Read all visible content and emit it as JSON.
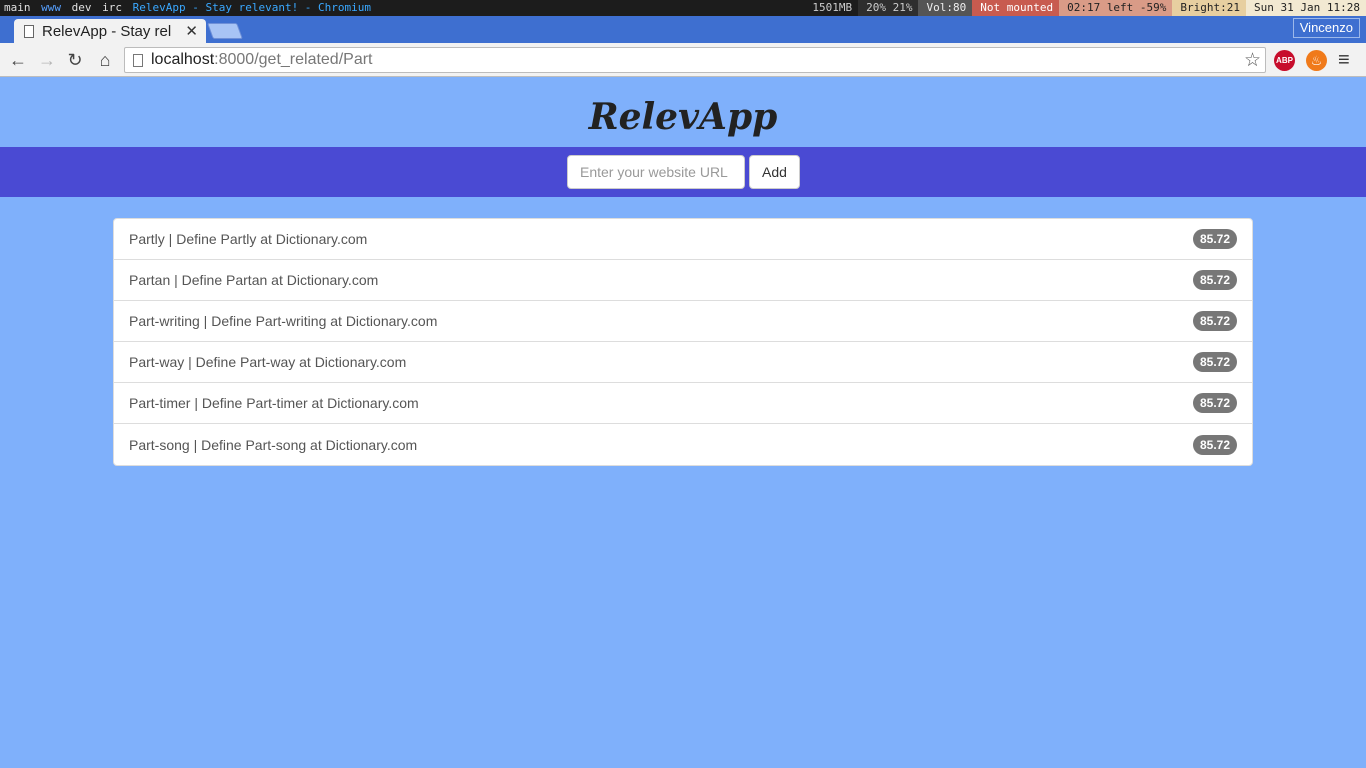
{
  "wm": {
    "ws_main": "main",
    "ws_www": "www",
    "ws_dev": "dev",
    "ws_irc": "irc",
    "window_title": "RelevApp - Stay relevant! - Chromium",
    "mem": "1501MB",
    "cpu": "20% 21%",
    "vol": "Vol:80",
    "mount": "Not mounted",
    "battery": "02:17 left -59%",
    "bright": "Bright:21",
    "clock": "Sun 31 Jan 11:28"
  },
  "browser": {
    "tab_title": "RelevApp - Stay rel",
    "profile": "Vincenzo",
    "url_host": "localhost",
    "url_rest": ":8000/get_related/Part"
  },
  "page": {
    "brand": "RelevApp",
    "url_placeholder": "Enter your website URL",
    "add_label": "Add",
    "results": [
      {
        "title": "Partly | Define Partly at Dictionary.com",
        "score": "85.72"
      },
      {
        "title": "Partan | Define Partan at Dictionary.com",
        "score": "85.72"
      },
      {
        "title": "Part-writing | Define Part-writing at Dictionary.com",
        "score": "85.72"
      },
      {
        "title": "Part-way | Define Part-way at Dictionary.com",
        "score": "85.72"
      },
      {
        "title": "Part-timer | Define Part-timer at Dictionary.com",
        "score": "85.72"
      },
      {
        "title": "Part-song | Define Part-song at Dictionary.com",
        "score": "85.72"
      }
    ]
  }
}
